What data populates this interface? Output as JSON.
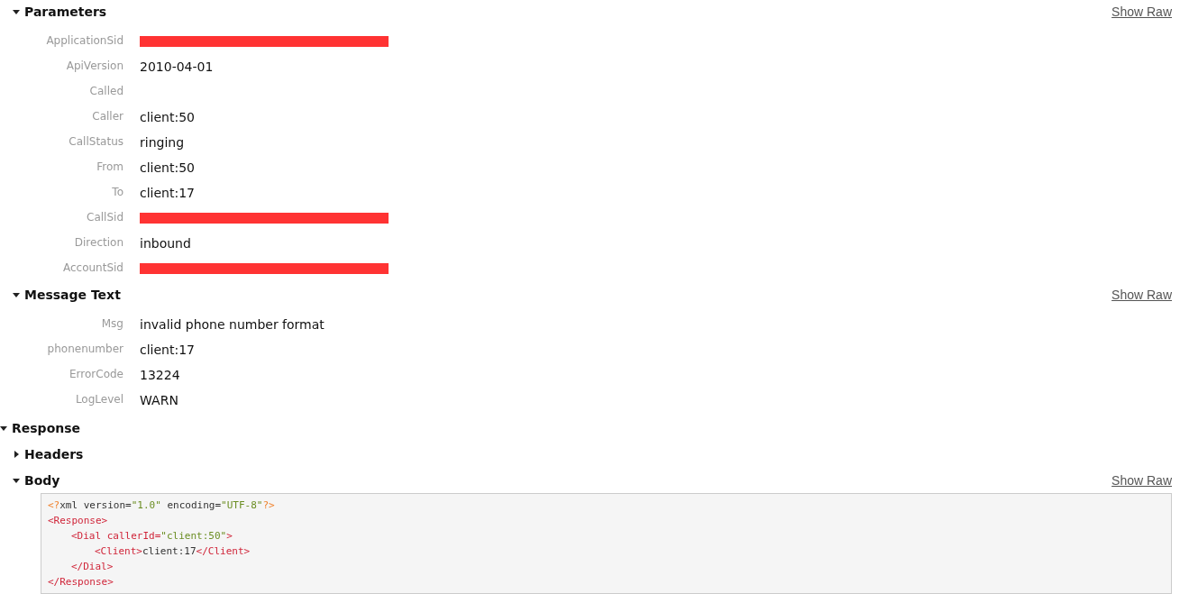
{
  "sections": [
    {
      "title": "Parameters",
      "expanded": true,
      "show_raw": "Show Raw",
      "rows": [
        {
          "label": "ApplicationSid",
          "redacted": true
        },
        {
          "label": "ApiVersion",
          "value": "2010-04-01"
        },
        {
          "label": "Called"
        },
        {
          "label": "Caller",
          "value": "client:50"
        },
        {
          "label": "CallStatus",
          "value": "ringing"
        },
        {
          "label": "From",
          "value": "client:50"
        },
        {
          "label": "To",
          "value": "client:17"
        },
        {
          "label": "CallSid",
          "redacted": true
        },
        {
          "label": "Direction",
          "value": "inbound"
        },
        {
          "label": "AccountSid",
          "redacted": true
        }
      ]
    },
    {
      "title": "Message Text",
      "expanded": true,
      "show_raw": "Show Raw",
      "rows": [
        {
          "label": "Msg",
          "value": "invalid phone number format"
        },
        {
          "label": "phonenumber",
          "value": "client:17"
        },
        {
          "label": "ErrorCode",
          "value": "13224"
        },
        {
          "label": "LogLevel",
          "value": "WARN"
        }
      ]
    }
  ],
  "response": {
    "title": "Response",
    "expanded": true,
    "children": [
      {
        "title": "Headers",
        "expanded": false
      },
      {
        "title": "Body",
        "expanded": true,
        "show_raw": "Show Raw",
        "code": [
          {
            "tokens": [
              {
                "kind": "punct",
                "text": "<?"
              },
              {
                "kind": "text",
                "text": "xml version="
              },
              {
                "kind": "string",
                "text": "\"1.0\""
              },
              {
                "kind": "text",
                "text": " encoding="
              },
              {
                "kind": "string",
                "text": "\"UTF-8\""
              },
              {
                "kind": "punct",
                "text": "?>"
              }
            ]
          },
          {
            "tokens": [
              {
                "kind": "tag",
                "text": "<Response>"
              }
            ],
            "children": [
              {
                "tokens": [
                  {
                    "kind": "tag",
                    "text": "<Dial callerId="
                  },
                  {
                    "kind": "string",
                    "text": "\"client:50\""
                  },
                  {
                    "kind": "tag",
                    "text": ">"
                  }
                ],
                "children": [
                  {
                    "tokens": [
                      {
                        "kind": "tag",
                        "text": "<Client>"
                      },
                      {
                        "kind": "text",
                        "text": "client:17"
                      },
                      {
                        "kind": "tag",
                        "text": "</Client>"
                      }
                    ]
                  }
                ]
              },
              {
                "tokens": [
                  {
                    "kind": "tag",
                    "text": "</Dial>"
                  }
                ]
              }
            ]
          },
          {
            "tokens": [
              {
                "kind": "tag",
                "text": "</Response>"
              }
            ]
          }
        ]
      }
    ]
  }
}
